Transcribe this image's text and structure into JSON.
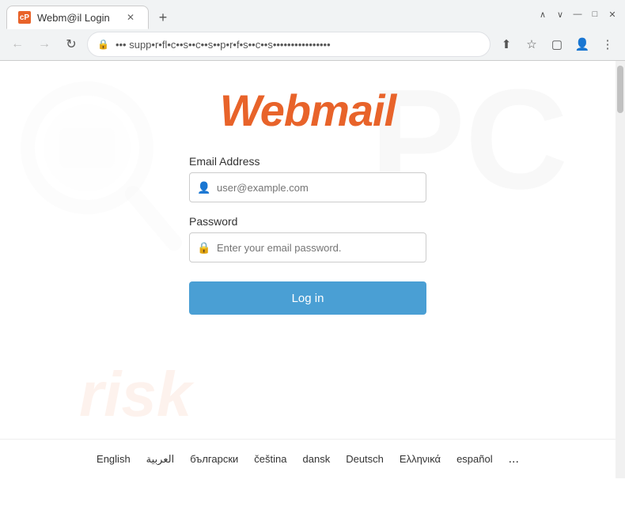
{
  "browser": {
    "tab_title": "Webm@il Login",
    "tab_favicon": "cP",
    "new_tab_label": "+",
    "nav_back": "←",
    "nav_forward": "→",
    "nav_refresh": "↻",
    "url": "••• supp•r•fl•c••s••c••s••p•r•f•s••c••s••••••••••••••••",
    "lock_icon": "🔒",
    "share_icon": "⬆",
    "bookmark_icon": "☆",
    "extensions_icon": "▢",
    "account_icon": "👤",
    "menu_icon": "⋮",
    "minimize_icon": "—",
    "maximize_icon": "□",
    "close_icon": "✕",
    "chevron_up": "∧",
    "chevron_down": "∨"
  },
  "page": {
    "logo_text": "Webmail",
    "background_pc_text": "PC",
    "background_risk_text": "risk"
  },
  "form": {
    "email_label": "Email Address",
    "email_placeholder": "user@example.com",
    "password_label": "Password",
    "password_placeholder": "Enter your email password.",
    "login_button": "Log in"
  },
  "languages": [
    {
      "code": "en",
      "label": "English",
      "active": true
    },
    {
      "code": "ar",
      "label": "العربية",
      "active": false
    },
    {
      "code": "bg",
      "label": "български",
      "active": false
    },
    {
      "code": "cs",
      "label": "čeština",
      "active": false
    },
    {
      "code": "da",
      "label": "dansk",
      "active": false
    },
    {
      "code": "de",
      "label": "Deutsch",
      "active": false
    },
    {
      "code": "el",
      "label": "Ελληνικά",
      "active": false
    },
    {
      "code": "es",
      "label": "español",
      "active": false
    }
  ],
  "lang_more": "..."
}
